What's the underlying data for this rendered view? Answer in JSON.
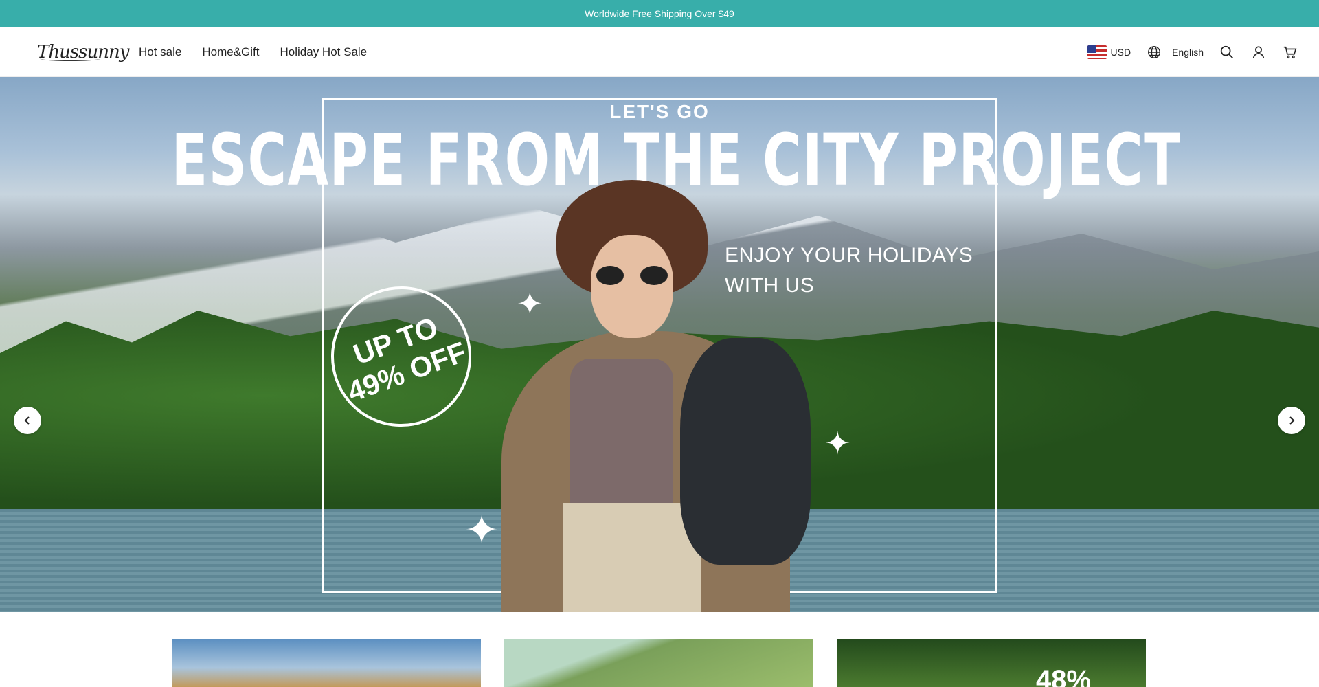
{
  "announcement": "Worldwide Free Shipping Over $49",
  "header": {
    "logo": "Thussunny",
    "nav": [
      "Hot sale",
      "Home&Gift",
      "Holiday Hot Sale"
    ],
    "currency": "USD",
    "language": "English",
    "icons": [
      "globe-icon",
      "search-icon",
      "account-icon",
      "cart-icon"
    ]
  },
  "hero": {
    "eyebrow": "LET'S GO",
    "headline": "ESCAPE FROM THE CITY PROJECT",
    "tagline_1": "ENJOY YOUR HOLIDAYS",
    "tagline_2": "WITH US",
    "badge_1": "UP TO",
    "badge_2": "49% OFF"
  },
  "cards": {
    "third_text": "48%"
  },
  "colors": {
    "announcement_bg": "#38aeaa"
  }
}
